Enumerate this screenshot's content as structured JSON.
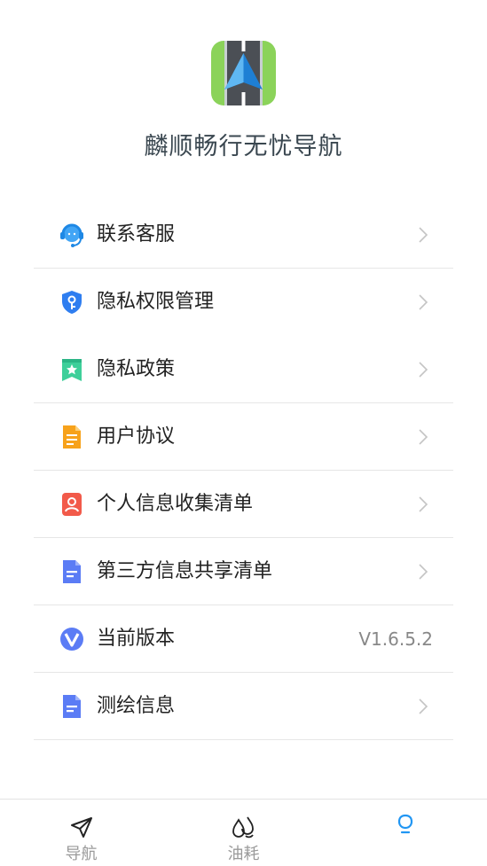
{
  "app": {
    "title": "麟顺畅行无忧导航",
    "icon": "road-navigation-arrow-icon"
  },
  "menu": {
    "items": [
      {
        "label": "联系客服",
        "icon": "customer-service-headset-icon",
        "color": "#42a5f5"
      },
      {
        "label": "隐私权限管理",
        "icon": "shield-key-icon",
        "color": "#2f7ef0"
      },
      {
        "label": "隐私政策",
        "icon": "star-bookmark-icon",
        "color": "#3ecf9a"
      },
      {
        "label": "用户协议",
        "icon": "document-icon",
        "color": "#f7a21b"
      },
      {
        "label": "个人信息收集清单",
        "icon": "person-card-icon",
        "color": "#f25a4a"
      },
      {
        "label": "第三方信息共享清单",
        "icon": "list-document-icon",
        "color": "#5b7cf5"
      },
      {
        "label": "当前版本",
        "icon": "version-v-icon",
        "color": "#5b7cf5",
        "value": "V1.6.5.2"
      },
      {
        "label": "测绘信息",
        "icon": "list-document-icon",
        "color": "#5b7cf5"
      }
    ]
  },
  "tabbar": {
    "tabs": [
      {
        "label": "导航",
        "icon": "navigation-arrow-icon"
      },
      {
        "label": "油耗",
        "icon": "fuel-drops-icon"
      },
      {
        "label": "",
        "icon": "profile-icon",
        "active": true,
        "color": "#2196f3"
      }
    ]
  }
}
